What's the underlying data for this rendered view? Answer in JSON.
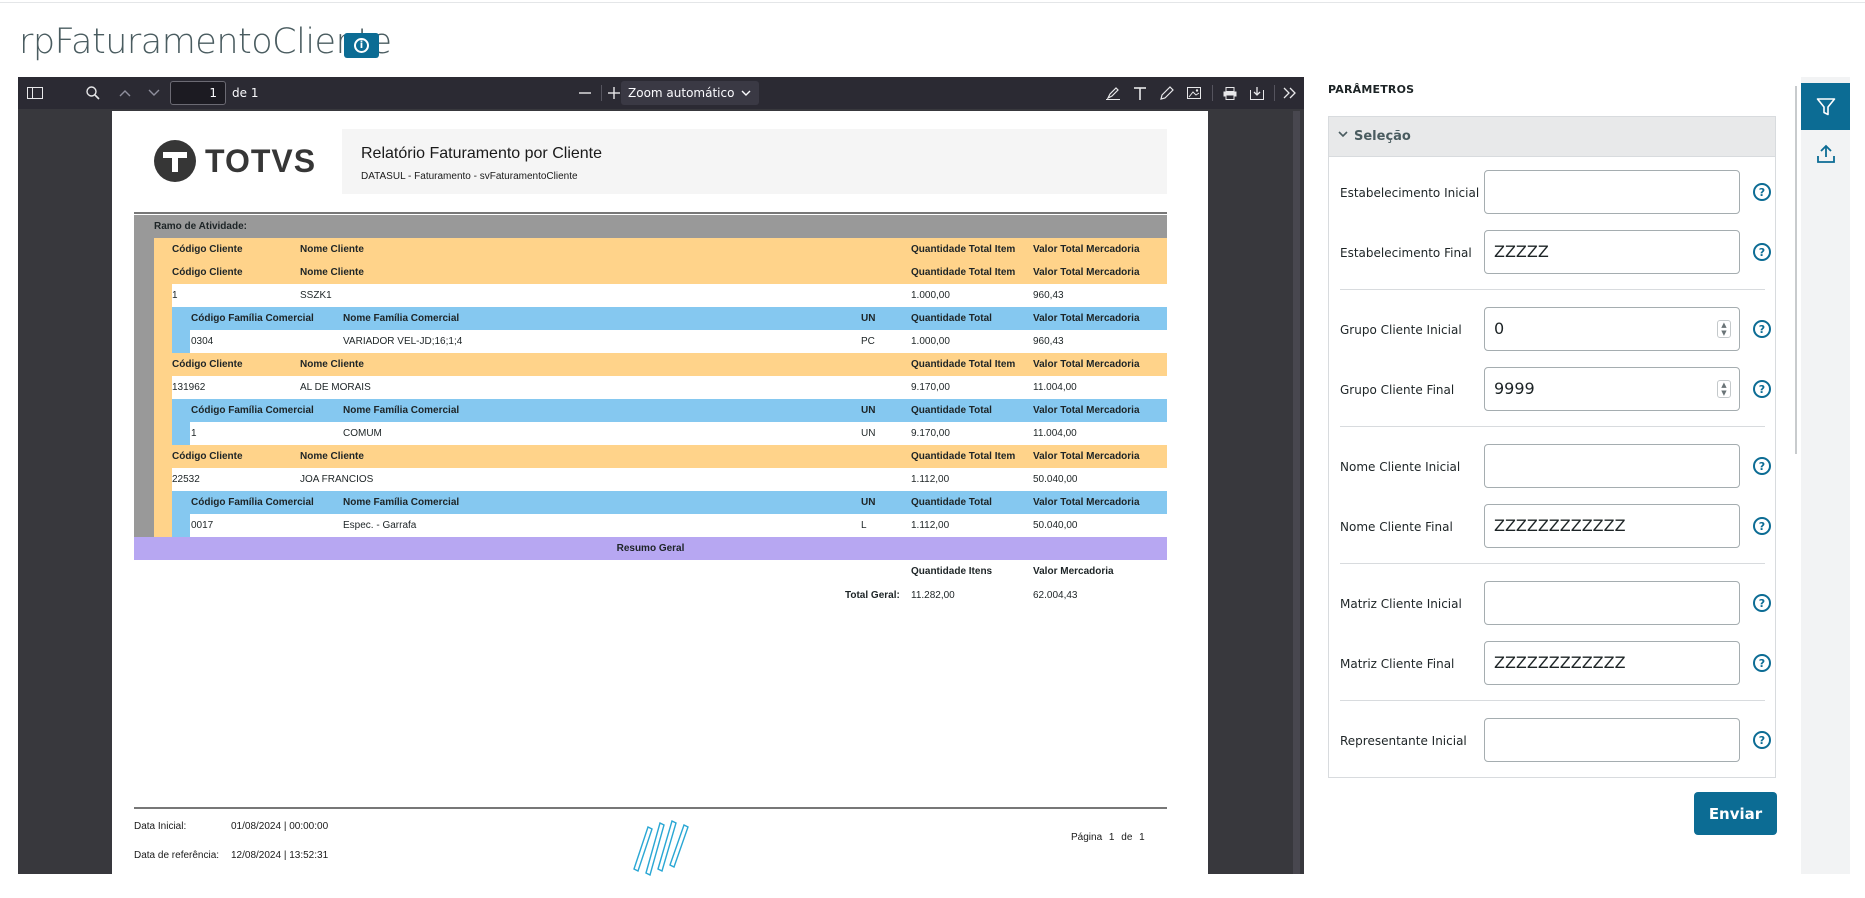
{
  "page": {
    "title": "rpFaturamentoCliente"
  },
  "viewer": {
    "page_number": "1",
    "page_of": "de 1",
    "zoom": "Zoom automático"
  },
  "report": {
    "logo_text": "TOTVS",
    "title": "Relatório Faturamento por Cliente",
    "subtitle": "DATASUL - Faturamento - svFaturamentoCliente",
    "ramo_label": "Ramo de Atividade:",
    "h_codigo_cliente": "Código Cliente",
    "h_nome_cliente": "Nome Cliente",
    "h_qtd_total_item": "Quantidade Total Item",
    "h_valor_total_merc": "Valor Total Mercadoria",
    "h_cod_familia": "Código Família Comercial",
    "h_nome_familia": "Nome Família Comercial",
    "h_un": "UN",
    "h_qtd_total": "Quantidade Total",
    "clients": [
      {
        "codigo": "1",
        "nome": "SSZK1",
        "qtd": "1.000,00",
        "valor": "960,43",
        "familia": {
          "codigo": "0304",
          "nome": "VARIADOR VEL-JD;16;1;4",
          "un": "PC",
          "qtd": "1.000,00",
          "valor": "960,43"
        }
      },
      {
        "codigo": "131962",
        "nome": "AL DE MORAIS",
        "qtd": "9.170,00",
        "valor": "11.004,00",
        "familia": {
          "codigo": "1",
          "nome": "COMUM",
          "un": "UN",
          "qtd": "9.170,00",
          "valor": "11.004,00"
        }
      },
      {
        "codigo": "22532",
        "nome": "JOA FRANCIOS",
        "qtd": "1.112,00",
        "valor": "50.040,00",
        "familia": {
          "codigo": "0017",
          "nome": "Espec. - Garrafa",
          "un": "L",
          "qtd": "1.112,00",
          "valor": "50.040,00"
        }
      }
    ],
    "resumo_label": "Resumo Geral",
    "resumo_qtd_header": "Quantidade Itens",
    "resumo_valor_header": "Valor Mercadoria",
    "total_label": "Total Geral:",
    "total_qtd": "11.282,00",
    "total_valor": "62.004,43",
    "footer": {
      "data_inicial_label": "Data Inicial:",
      "data_inicial": "01/08/2024 | 00:00:00",
      "data_ref_label": "Data de referência:",
      "data_ref": "12/08/2024 | 13:52:31",
      "pagina_label": "Página",
      "pagina": "1",
      "de_label": "de",
      "total_paginas": "1"
    }
  },
  "panel": {
    "title": "PARÂMETROS",
    "section": "Seleção",
    "fields": [
      {
        "label": "Estabelecimento Inicial",
        "value": ""
      },
      {
        "label": "Estabelecimento Final",
        "value": "ZZZZZ"
      },
      {
        "label": "Grupo Cliente Inicial",
        "value": "0"
      },
      {
        "label": "Grupo Cliente Final",
        "value": "9999"
      },
      {
        "label": "Nome Cliente Inicial",
        "value": ""
      },
      {
        "label": "Nome Cliente Final",
        "value": "ZZZZZZZZZZZZ"
      },
      {
        "label": "Matriz Cliente Inicial",
        "value": ""
      },
      {
        "label": "Matriz Cliente Final",
        "value": "ZZZZZZZZZZZZ"
      },
      {
        "label": "Representante Inicial",
        "value": ""
      }
    ],
    "send_label": "Enviar"
  }
}
